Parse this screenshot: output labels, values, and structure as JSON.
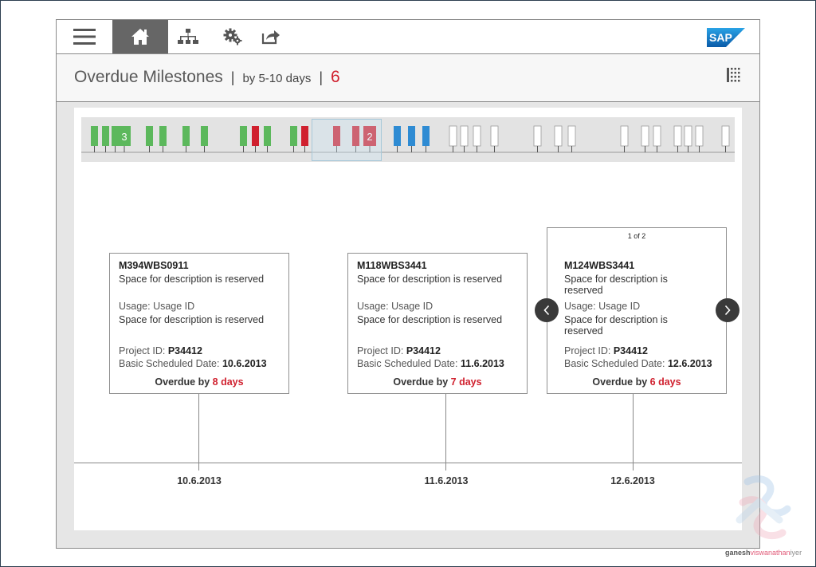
{
  "header": {
    "title": "Overdue Milestones",
    "separator": "|",
    "filter": "by 5-10 days",
    "count": "6"
  },
  "toolbar": {
    "items": [
      "menu-icon",
      "home-icon",
      "org-chart-icon",
      "settings-icon",
      "share-icon"
    ],
    "active": "home-icon",
    "brand": "SAP"
  },
  "overview": {
    "cluster_badges": [
      "3",
      "2"
    ],
    "colors": {
      "green": "#5cb85c",
      "red": "#d0202e",
      "blue": "#2e8bd3",
      "white": "#ffffff"
    }
  },
  "cards": [
    {
      "id": "M394WBS0911",
      "description": "Space for description is reserved",
      "usage_label": "Usage: Usage ID",
      "usage_description": "Space for description is reserved",
      "project_label": "Project ID:",
      "project_id": "P34412",
      "date_label": "Basic Scheduled Date:",
      "date": "10.6.2013",
      "overdue_label": "Overdue by",
      "overdue_value": "8 days"
    },
    {
      "id": "M118WBS3441",
      "description": "Space for description is reserved",
      "usage_label": "Usage: Usage ID",
      "usage_description": "Space for description is reserved",
      "project_label": "Project ID:",
      "project_id": "P34412",
      "date_label": "Basic Scheduled Date:",
      "date": "11.6.2013",
      "overdue_label": "Overdue by",
      "overdue_value": "7 days"
    },
    {
      "pager": "1 of 2",
      "id": "M124WBS3441",
      "description": "Space for description is reserved",
      "usage_label": "Usage: Usage ID",
      "usage_description": "Space for description is reserved",
      "project_label": "Project ID:",
      "project_id": "P34412",
      "date_label": "Basic Scheduled Date:",
      "date": "12.6.2013",
      "overdue_label": "Overdue by",
      "overdue_value": "6 days"
    }
  ],
  "timeline": {
    "dates": [
      "10.6.2013",
      "11.6.2013",
      "12.6.2013"
    ]
  },
  "footer": {
    "credit_1": "ganesh",
    "credit_2": "viswanathan",
    "credit_3": "iyer"
  },
  "accent_color": "#d0202e"
}
